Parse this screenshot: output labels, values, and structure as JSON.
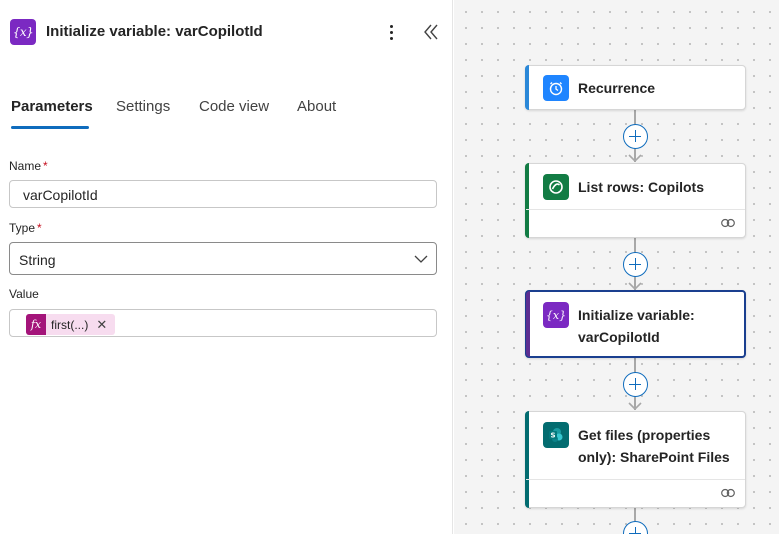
{
  "panel": {
    "title": "Initialize variable: varCopilotId",
    "icon": "variable-icon",
    "tabs": [
      {
        "label": "Parameters",
        "active": true
      },
      {
        "label": "Settings",
        "active": false
      },
      {
        "label": "Code view",
        "active": false
      },
      {
        "label": "About",
        "active": false
      }
    ],
    "fields": {
      "name": {
        "label": "Name",
        "required": "*",
        "value": "varCopilotId"
      },
      "type": {
        "label": "Type",
        "required": "*",
        "value": "String"
      },
      "value": {
        "label": "Value",
        "token": "first(...)",
        "token_icon": "fx"
      }
    }
  },
  "flow": {
    "nodes": [
      {
        "title": "Recurrence",
        "icon": "clock-icon",
        "accent": "#2b88d8"
      },
      {
        "title": "List rows: Copilots",
        "icon": "dataverse-icon",
        "accent": "#127c44"
      },
      {
        "title_line1": "Initialize variable:",
        "title_line2": "varCopilotId",
        "icon": "variable-icon",
        "accent": "#5c2e91"
      },
      {
        "title_line1": "Get files (properties",
        "title_line2": "only): SharePoint Files",
        "icon": "sharepoint-icon",
        "accent": "#036c70"
      }
    ]
  },
  "colors": {
    "variable": "#7b29c2",
    "selected_border": "#1a3f8f",
    "tab_underline": "#0f6cbd",
    "plus_button": "#0f6cbd"
  }
}
